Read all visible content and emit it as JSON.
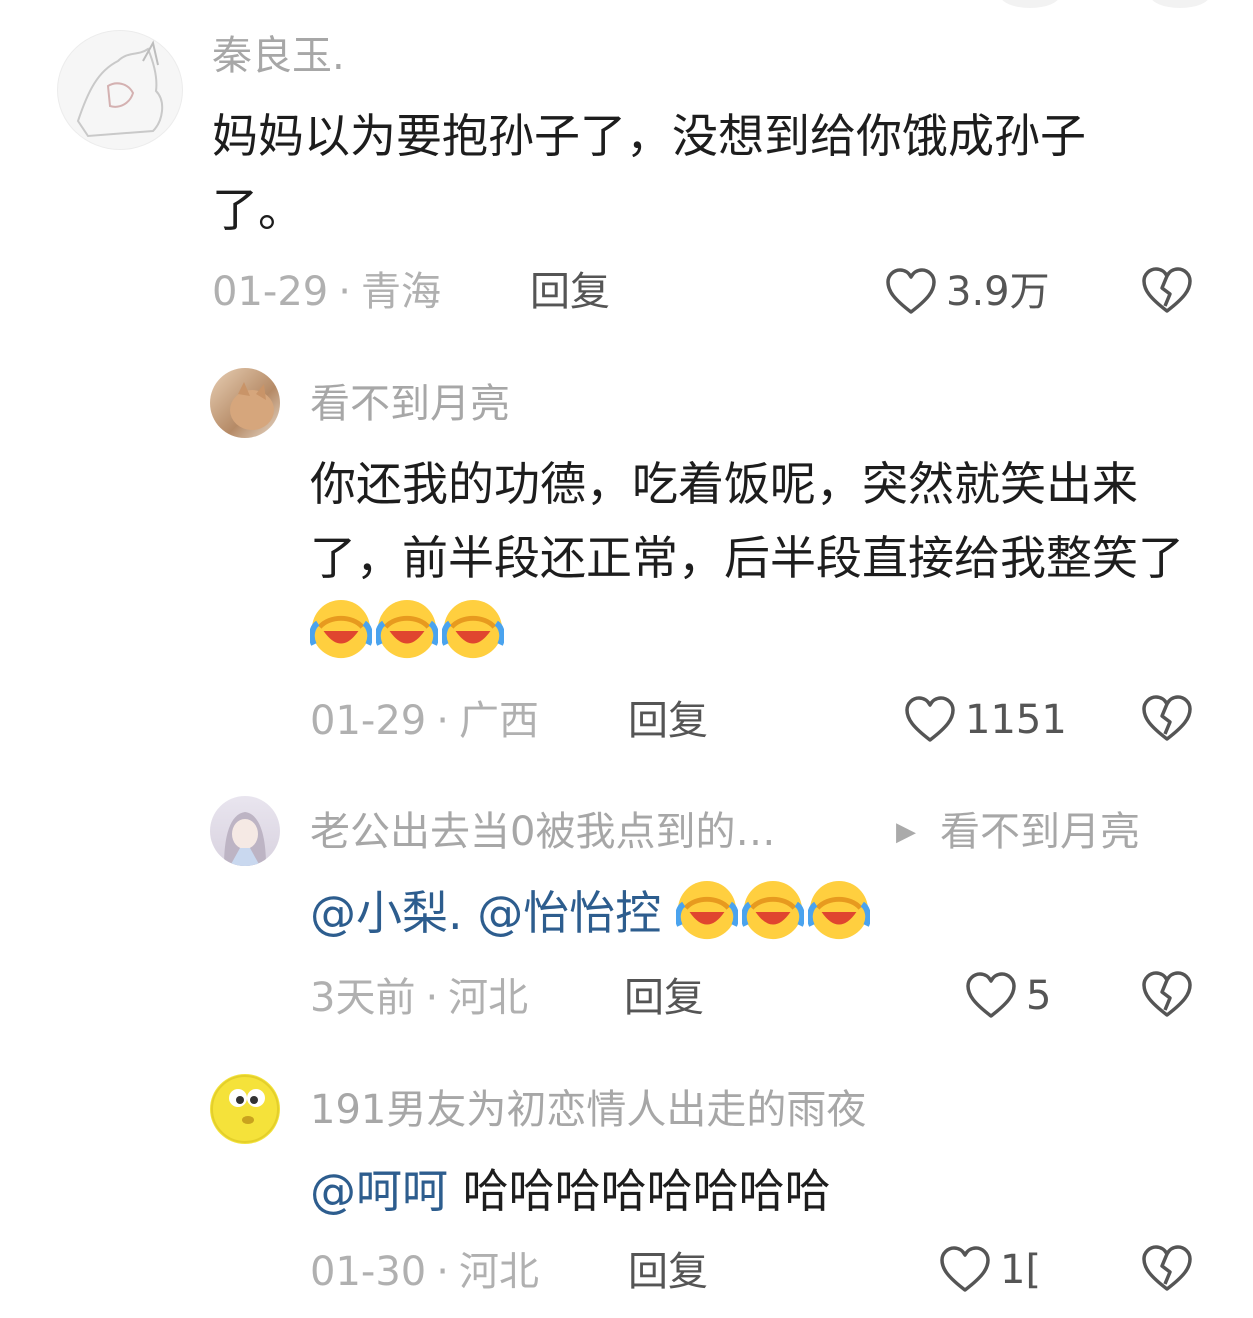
{
  "comments": [
    {
      "username": "秦良玉.",
      "text": "妈妈以为要抱孙子了，没想到给你饿成孙子了。",
      "date": "01-29",
      "location": "青海",
      "reply_label": "回复",
      "likes": "3.9万"
    },
    {
      "username": "看不到月亮",
      "text": "你还我的功德，吃着饭呢，突然就笑出来了，前半段还正常，后半段直接给我整笑了",
      "emoji": [
        "laugh-cry-emoji",
        "laugh-cry-emoji",
        "laugh-cry-emoji"
      ],
      "date": "01-29",
      "location": "广西",
      "reply_label": "回复",
      "likes": "1151"
    },
    {
      "username": "老公出去当0被我点到的…",
      "reply_to": "看不到月亮",
      "mention1": "@小梨.",
      "mention2": "@怡怡控",
      "emoji": [
        "laugh-cry-emoji",
        "laugh-cry-emoji",
        "laugh-cry-emoji"
      ],
      "date": "3天前",
      "location": "河北",
      "reply_label": "回复",
      "likes": "5"
    },
    {
      "username": "191男友为初恋情人出走的雨夜",
      "mention": "@呵呵",
      "text": "哈哈哈哈哈哈哈哈",
      "date": "01-30",
      "location": "河北",
      "reply_label": "回复",
      "likes": "1["
    }
  ],
  "meta_separator": "·",
  "colors": {
    "username": "#a7a7a7",
    "text": "#1d1d1d",
    "meta": "#b0b0b0",
    "mention": "#2d5d8e"
  }
}
